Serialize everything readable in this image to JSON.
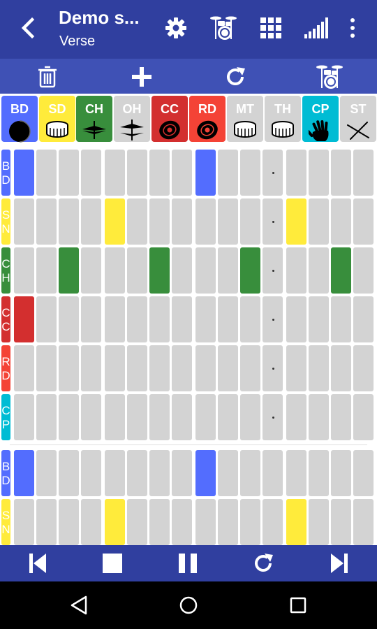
{
  "appbar": {
    "title": "Demo s...",
    "subtitle": "Verse",
    "bg": "#303f9f"
  },
  "toolbar": {
    "bg": "#3f51b5"
  },
  "instruments": [
    {
      "label": "BD",
      "color": "#536dfe",
      "text": "#ffffff",
      "icon": "bass-drum-icon"
    },
    {
      "label": "SD",
      "color": "#ffeb3b",
      "text": "#ffffff",
      "icon": "snare-drum-icon"
    },
    {
      "label": "CH",
      "color": "#388e3c",
      "text": "#ffffff",
      "icon": "closed-hihat-icon"
    },
    {
      "label": "OH",
      "color": "#d3d3d3",
      "text": "#ffffff",
      "icon": "open-hihat-icon"
    },
    {
      "label": "CC",
      "color": "#d32f2f",
      "text": "#ffffff",
      "icon": "crash-cymbal-icon"
    },
    {
      "label": "RD",
      "color": "#f44336",
      "text": "#ffffff",
      "icon": "ride-cymbal-icon"
    },
    {
      "label": "MT",
      "color": "#d3d3d3",
      "text": "#ffffff",
      "icon": "mid-tom-icon"
    },
    {
      "label": "TH",
      "color": "#d3d3d3",
      "text": "#ffffff",
      "icon": "high-tom-icon"
    },
    {
      "label": "CP",
      "color": "#00bcd4",
      "text": "#ffffff",
      "icon": "clap-icon"
    },
    {
      "label": "ST",
      "color": "#d3d3d3",
      "text": "#ffffff",
      "icon": "sticks-icon"
    }
  ],
  "grid": {
    "cell_color": "#d3d3d3",
    "dot_step": 12,
    "sections": [
      {
        "rows": [
          {
            "name": "BD",
            "letters": [
              "B",
              "D"
            ],
            "color": "#536dfe",
            "active": [
              0,
              8
            ]
          },
          {
            "name": "SN",
            "letters": [
              "S",
              "N"
            ],
            "color": "#ffeb3b",
            "active": [
              4,
              12
            ]
          },
          {
            "name": "CH",
            "letters": [
              "C",
              "H"
            ],
            "color": "#388e3c",
            "active": [
              2,
              6,
              10,
              14
            ]
          },
          {
            "name": "CC",
            "letters": [
              "C",
              "C"
            ],
            "color": "#d32f2f",
            "active": [
              0
            ]
          },
          {
            "name": "RD",
            "letters": [
              "R",
              "D"
            ],
            "color": "#f44336",
            "active": []
          },
          {
            "name": "CP",
            "letters": [
              "C",
              "P"
            ],
            "color": "#00bcd4",
            "active": []
          }
        ]
      },
      {
        "rows": [
          {
            "name": "BD",
            "letters": [
              "B",
              "D"
            ],
            "color": "#536dfe",
            "active": [
              0,
              8
            ]
          },
          {
            "name": "SN",
            "letters": [
              "S",
              "N"
            ],
            "color": "#ffeb3b",
            "active": [
              4,
              12
            ]
          }
        ]
      }
    ]
  },
  "transport": {
    "bg": "#303f9f"
  }
}
